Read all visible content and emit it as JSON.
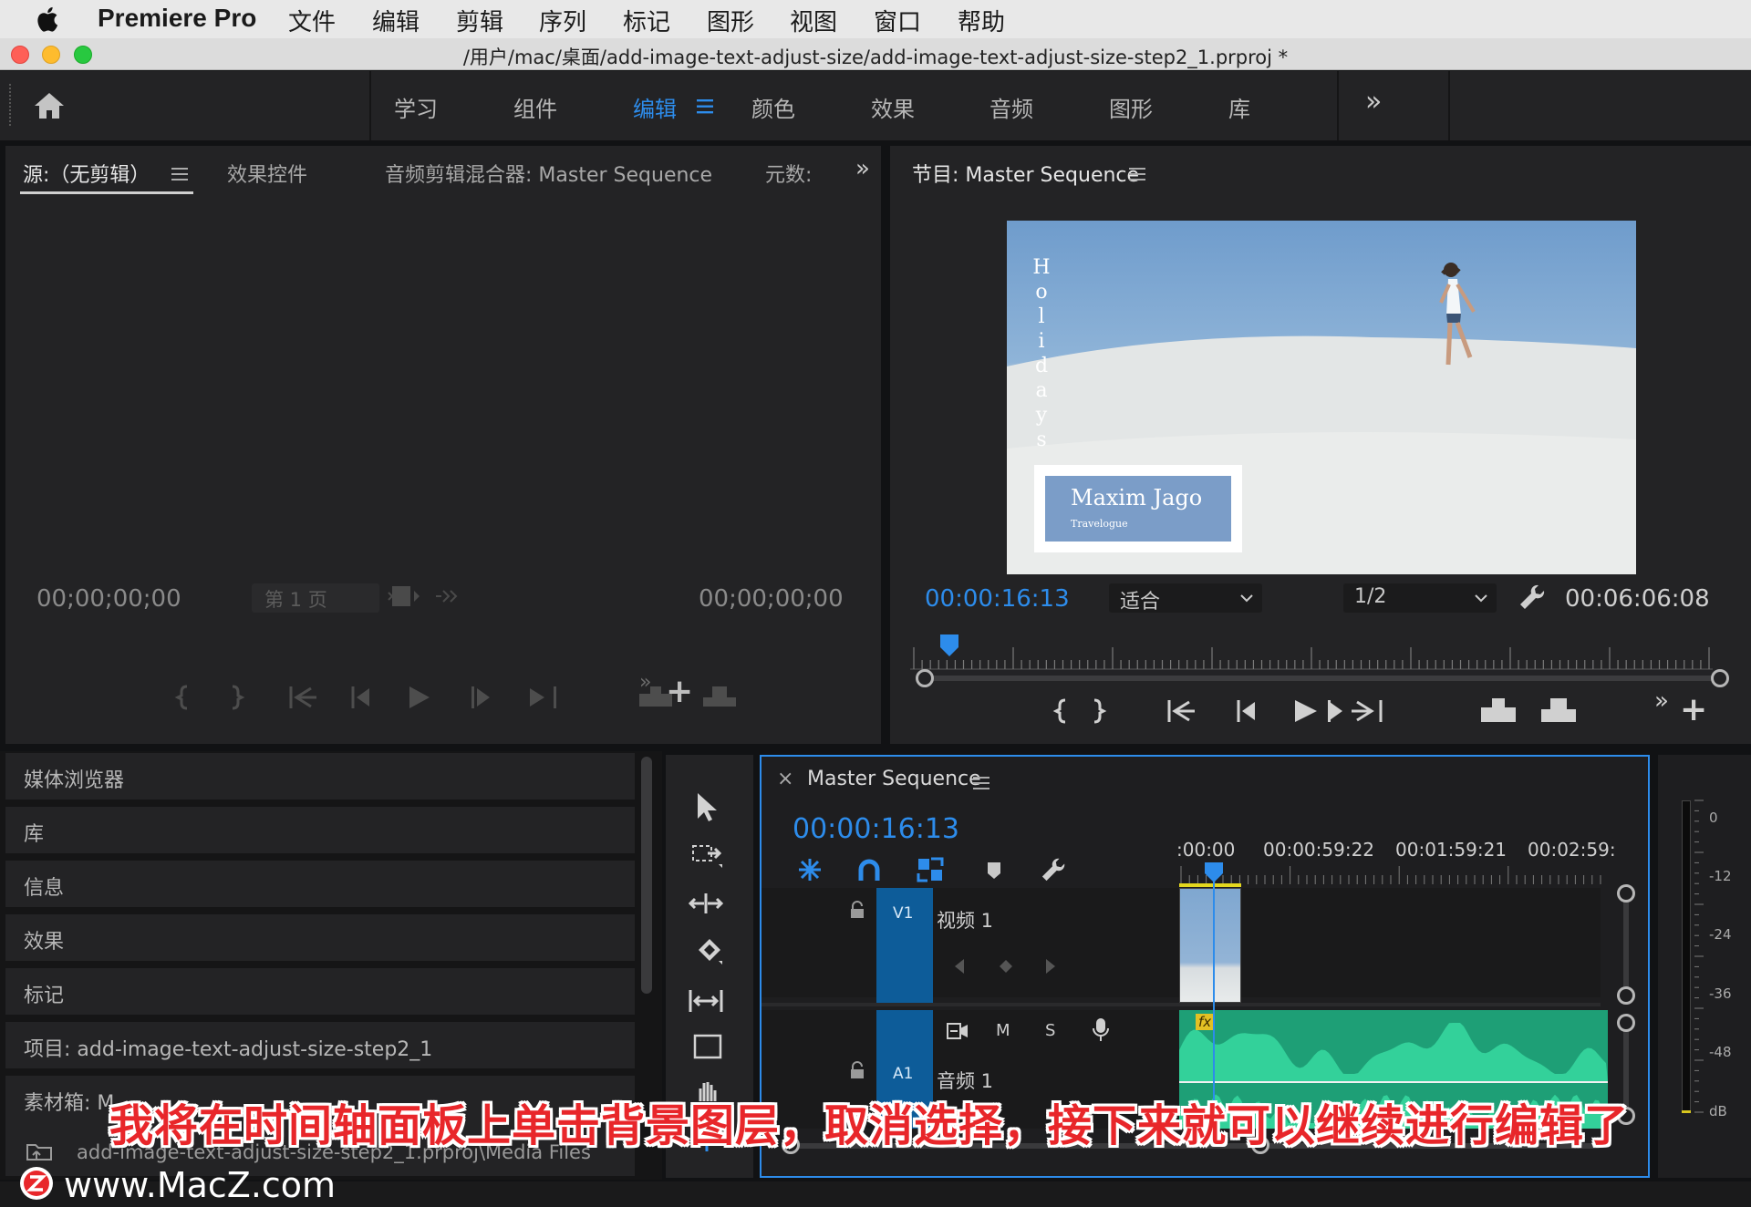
{
  "menubar": {
    "app": "Premiere Pro",
    "items": [
      "文件",
      "编辑",
      "剪辑",
      "序列",
      "标记",
      "图形",
      "视图",
      "窗口",
      "帮助"
    ]
  },
  "window": {
    "title": "/用户/mac/桌面/add-image-text-adjust-size/add-image-text-adjust-size-step2_1.prproj *"
  },
  "workspaces": {
    "items": [
      "学习",
      "组件",
      "编辑",
      "颜色",
      "效果",
      "音频",
      "图形",
      "库"
    ],
    "active": "编辑",
    "more": "»"
  },
  "source_panel": {
    "tabs": [
      "源:（无剪辑）",
      "效果控件",
      "音频剪辑混合器: Master Sequence",
      "元数:"
    ],
    "more": "»",
    "timecode_left": "00;00;00;00",
    "timecode_right": "00;00;00;00",
    "page": "第 1 页"
  },
  "program_panel": {
    "title": "节目: Master Sequence",
    "timecode": "00:00:16:13",
    "fit": "适合",
    "resolution": "1/2",
    "duration": "00:06:06:08",
    "playhead_fraction": 0.045,
    "overlay": {
      "vertical_text": [
        "H",
        "o",
        "l",
        "i",
        "d",
        "a",
        "y",
        "s"
      ],
      "name": "Maxim Jago",
      "subtitle": "Travelogue"
    }
  },
  "left_dock": {
    "items": [
      "媒体浏览器",
      "库",
      "信息",
      "效果",
      "标记",
      "项目: add-image-text-adjust-size-step2_1",
      "素材箱: M"
    ],
    "path": "add-image-text-adjust-size-step2_1.prproj\\Media Files"
  },
  "timeline": {
    "close": "×",
    "title": "Master Sequence",
    "timecode": "00:00:16:13",
    "ruler": [
      ":00:00",
      "00:00:59:22",
      "00:01:59:21",
      "00:02:59:"
    ],
    "tracks": {
      "v1": {
        "label": "V1",
        "name": "视频 1"
      },
      "a1": {
        "label": "A1",
        "name": "音频 1",
        "m": "M",
        "s": "S",
        "fx": "fx"
      }
    }
  },
  "audio_meter": {
    "labels": [
      "0",
      "-12",
      "-24",
      "-36",
      "-48",
      "dB"
    ]
  },
  "caption": "我将在时间轴面板上单击背景图层，取消选择，接下来就可以继续进行编辑了",
  "watermark": "www.MacZ.com",
  "colors": {
    "accent": "#2d8ceb",
    "panel": "#232325",
    "audio_clip": "#1e9f76",
    "waveform": "#33d19a",
    "caption_red": "#e8262a"
  }
}
